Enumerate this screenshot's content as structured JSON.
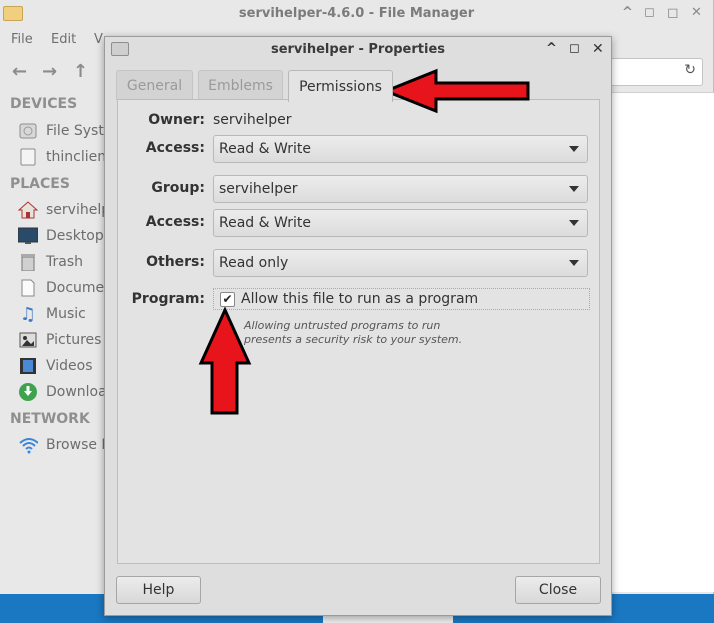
{
  "file_manager": {
    "title": "servihelper-4.6.0 - File Manager",
    "controls": {
      "minimize": "^",
      "maximize": "◻",
      "close": "✕"
    },
    "menu": [
      "File",
      "Edit",
      "V"
    ],
    "nav": {
      "back": "←",
      "forward": "→",
      "up": "↑"
    },
    "reload_icon": "↻",
    "sidebar": {
      "devices_heading": "DEVICES",
      "devices": [
        {
          "label": "File Syste",
          "icon": "drive-icon"
        },
        {
          "label": "thinclient",
          "icon": "disk-icon"
        }
      ],
      "places_heading": "PLACES",
      "places": [
        {
          "label": "servihelp",
          "icon": "home-icon"
        },
        {
          "label": "Desktop",
          "icon": "desktop-icon"
        },
        {
          "label": "Trash",
          "icon": "trash-icon"
        },
        {
          "label": "Documen",
          "icon": "document-icon"
        },
        {
          "label": "Music",
          "icon": "music-icon"
        },
        {
          "label": "Pictures",
          "icon": "pictures-icon"
        },
        {
          "label": "Videos",
          "icon": "videos-icon"
        },
        {
          "label": "Downloa",
          "icon": "download-icon"
        }
      ],
      "network_heading": "NETWORK",
      "network": [
        {
          "label": "Browse N",
          "icon": "wifi-icon"
        }
      ]
    }
  },
  "dialog": {
    "title": "servihelper - Properties",
    "controls": {
      "minimize": "^",
      "maximize": "◻",
      "close": "✕"
    },
    "tabs": [
      "General",
      "Emblems",
      "Permissions"
    ],
    "active_tab": "Permissions",
    "owner": {
      "label": "Owner:",
      "value": "servihelper"
    },
    "owner_access": {
      "label": "Access:",
      "value": "Read & Write"
    },
    "group": {
      "label": "Group:",
      "value": "servihelper"
    },
    "group_access": {
      "label": "Access:",
      "value": "Read & Write"
    },
    "others": {
      "label": "Others:",
      "value": "Read only"
    },
    "program": {
      "label": "Program:",
      "checkbox_label": "Allow this file to run as a program",
      "checked": true,
      "check_mark": "✔",
      "hint_line1": "Allowing untrusted programs to run",
      "hint_line2": "presents a security risk to your system."
    },
    "buttons": {
      "help": "Help",
      "close": "Close"
    }
  },
  "annotations": {
    "arrow_color": "#e8141c"
  }
}
